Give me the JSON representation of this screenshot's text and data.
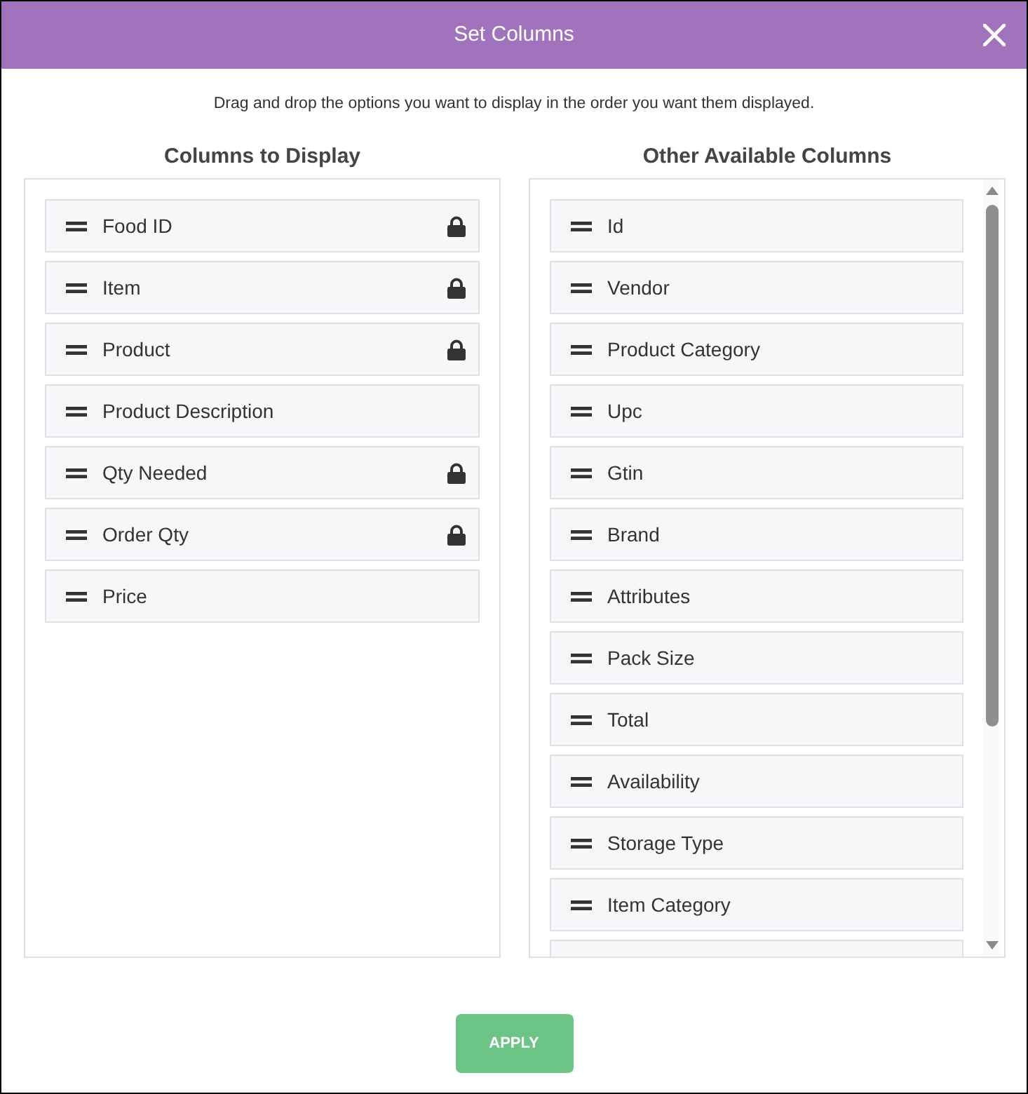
{
  "dialog": {
    "title": "Set Columns"
  },
  "instruction": "Drag and drop the options you want to display in the order you want them displayed.",
  "columns_to_display": {
    "heading": "Columns to Display",
    "items": [
      {
        "label": "Food ID",
        "locked": true
      },
      {
        "label": "Item",
        "locked": true
      },
      {
        "label": "Product",
        "locked": true
      },
      {
        "label": "Product Description",
        "locked": false
      },
      {
        "label": "Qty Needed",
        "locked": true
      },
      {
        "label": "Order Qty",
        "locked": true
      },
      {
        "label": "Price",
        "locked": false
      }
    ]
  },
  "other_available_columns": {
    "heading": "Other Available Columns",
    "items": [
      {
        "label": "Id"
      },
      {
        "label": "Vendor"
      },
      {
        "label": "Product Category"
      },
      {
        "label": "Upc"
      },
      {
        "label": "Gtin"
      },
      {
        "label": "Brand"
      },
      {
        "label": "Attributes"
      },
      {
        "label": "Pack Size"
      },
      {
        "label": "Total"
      },
      {
        "label": "Availability"
      },
      {
        "label": "Storage Type"
      },
      {
        "label": "Item Category"
      }
    ]
  },
  "apply_button": {
    "label": "APPLY"
  }
}
